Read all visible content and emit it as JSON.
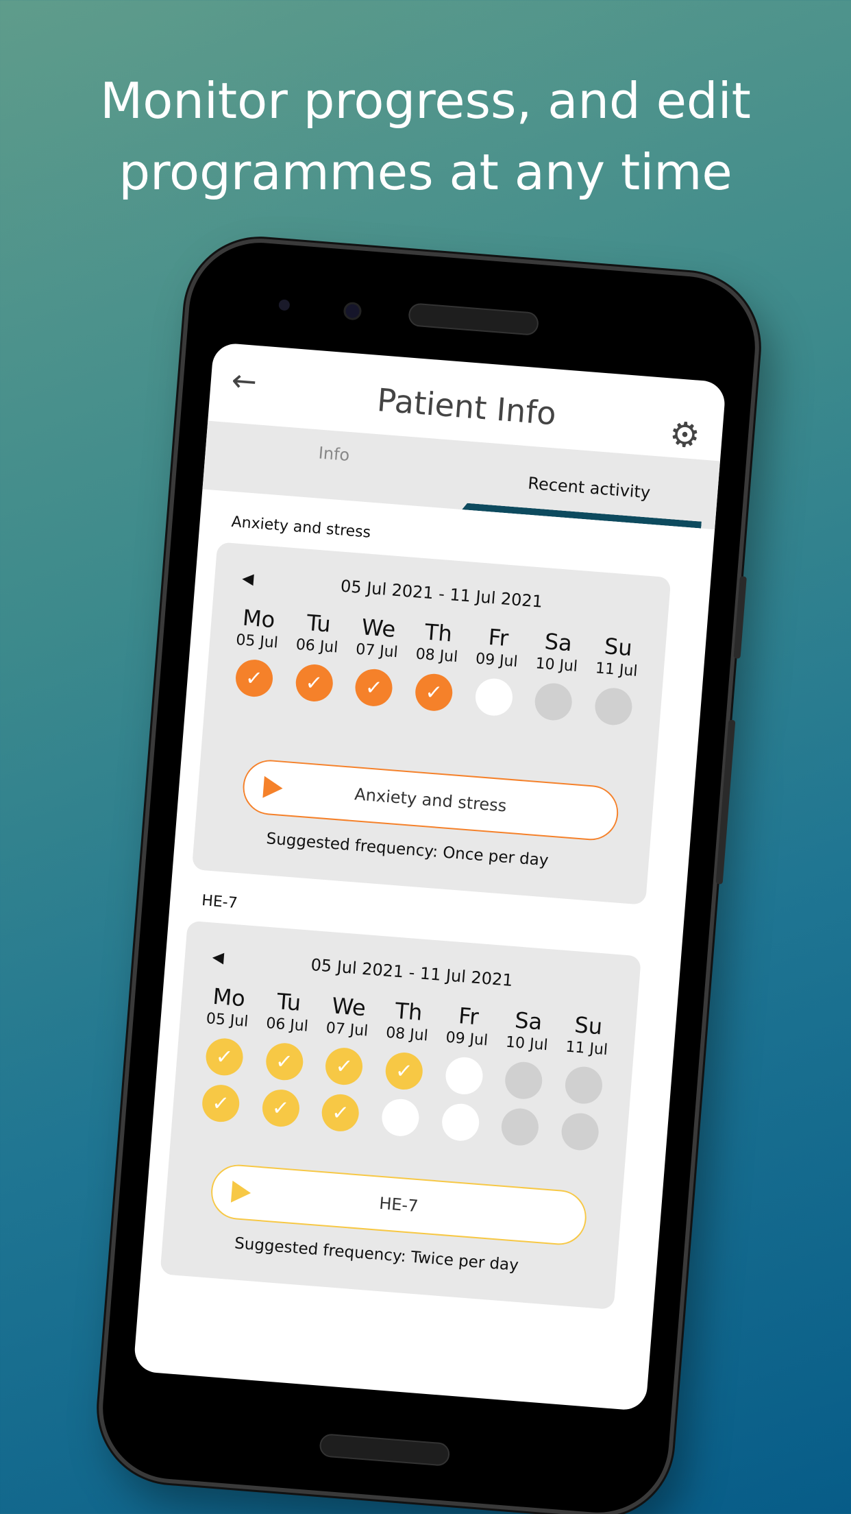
{
  "headline": "Monitor progress, and edit programmes at any time",
  "app": {
    "title": "Patient Info",
    "back_icon": "arrow-left-icon",
    "settings_icon": "gear-icon"
  },
  "tabs": [
    {
      "label": "Info",
      "active": false
    },
    {
      "label": "Recent activity",
      "active": true
    }
  ],
  "colors": {
    "orange": "#f5812a",
    "yellow": "#f7c845",
    "tab_indicator": "#0d4a5e",
    "card_bg": "#e8e8e8",
    "pending": "#ffffff",
    "future": "#d0d0d0"
  },
  "programmes": [
    {
      "name": "Anxiety and stress",
      "range": "05 Jul 2021 - 11 Jul 2021",
      "color": "#f5812a",
      "days": [
        {
          "name": "Mo",
          "date": "05 Jul"
        },
        {
          "name": "Tu",
          "date": "06 Jul"
        },
        {
          "name": "We",
          "date": "07 Jul"
        },
        {
          "name": "Th",
          "date": "08 Jul"
        },
        {
          "name": "Fr",
          "date": "09 Jul"
        },
        {
          "name": "Sa",
          "date": "10 Jul"
        },
        {
          "name": "Su",
          "date": "11 Jul"
        }
      ],
      "sessions": [
        [
          "done",
          "done",
          "done",
          "done",
          "pending",
          "future",
          "future"
        ]
      ],
      "button_label": "Anxiety and stress",
      "frequency": "Suggested frequency: Once per day"
    },
    {
      "name": "HE-7",
      "range": "05 Jul 2021 - 11 Jul 2021",
      "color": "#f7c845",
      "days": [
        {
          "name": "Mo",
          "date": "05 Jul"
        },
        {
          "name": "Tu",
          "date": "06 Jul"
        },
        {
          "name": "We",
          "date": "07 Jul"
        },
        {
          "name": "Th",
          "date": "08 Jul"
        },
        {
          "name": "Fr",
          "date": "09 Jul"
        },
        {
          "name": "Sa",
          "date": "10 Jul"
        },
        {
          "name": "Su",
          "date": "11 Jul"
        }
      ],
      "sessions": [
        [
          "done",
          "done",
          "done",
          "done",
          "pending",
          "future",
          "future"
        ],
        [
          "done",
          "done",
          "done",
          "pending",
          "pending",
          "future",
          "future"
        ]
      ],
      "button_label": "HE-7",
      "frequency": "Suggested frequency: Twice per day"
    }
  ]
}
